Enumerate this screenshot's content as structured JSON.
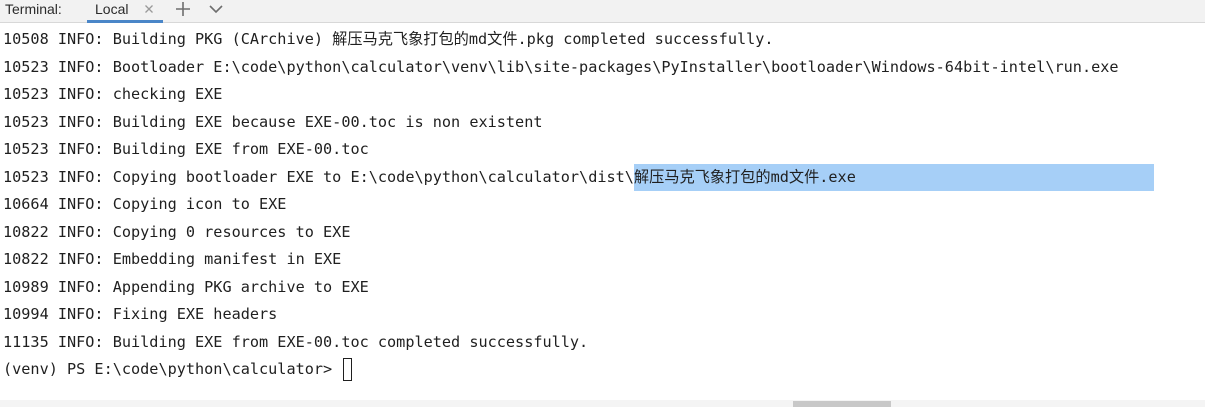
{
  "tabbar": {
    "title": "Terminal:",
    "active_tab": "Local",
    "icons": [
      "close-icon",
      "plus-icon",
      "chevron-down-icon"
    ]
  },
  "terminal": {
    "lines": [
      "10508 INFO: Building PKG (CArchive) 解压马克飞象打包的md文件.pkg completed successfully.",
      "10523 INFO: Bootloader E:\\code\\python\\calculator\\venv\\lib\\site-packages\\PyInstaller\\bootloader\\Windows-64bit-intel\\run.exe",
      "10523 INFO: checking EXE",
      "10523 INFO: Building EXE because EXE-00.toc is non existent",
      "10523 INFO: Building EXE from EXE-00.toc",
      "10664 INFO: Copying icon to EXE",
      "10822 INFO: Copying 0 resources to EXE",
      "10822 INFO: Embedding manifest in EXE",
      "10989 INFO: Appending PKG archive to EXE",
      "10994 INFO: Fixing EXE headers",
      "11135 INFO: Building EXE from EXE-00.toc completed successfully."
    ],
    "copy_line": {
      "prefix": "10523 INFO: Copying bootloader EXE to E:\\code\\python\\calculator\\dist\\",
      "selected": "解压马克飞象打包的md文件.exe"
    },
    "prompt": "(venv) PS E:\\code\\python\\calculator> ",
    "colors": {
      "selection": "#a6cff7",
      "tab_underline": "#4a86c8"
    }
  }
}
